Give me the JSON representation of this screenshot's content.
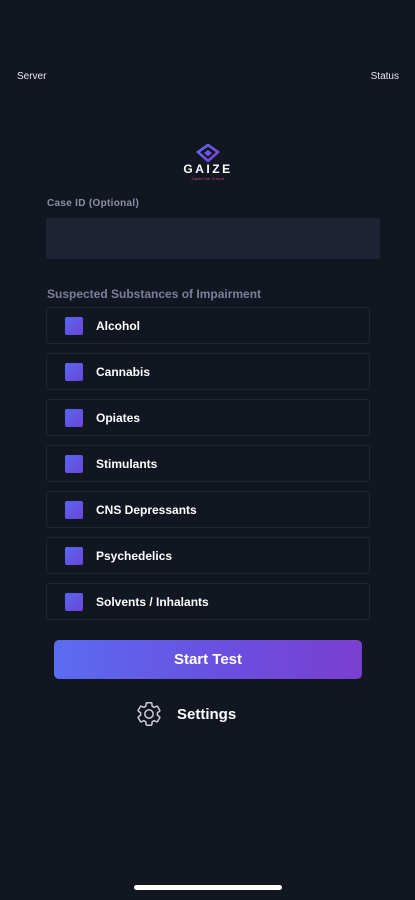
{
  "top_bar": {
    "server_label": "Server",
    "status_label": "Status"
  },
  "logo": {
    "wordmark": "GAIZE",
    "tagline": "Gaize the Future",
    "icon": "gaize-logo-icon"
  },
  "case_id": {
    "label": "Case ID (Optional)",
    "value": "",
    "placeholder": ""
  },
  "substances": {
    "section_label": "Suspected Substances of Impairment",
    "items": [
      {
        "label": "Alcohol"
      },
      {
        "label": "Cannabis"
      },
      {
        "label": "Opiates"
      },
      {
        "label": "Stimulants"
      },
      {
        "label": "CNS Depressants"
      },
      {
        "label": "Psychedelics"
      },
      {
        "label": "Solvents / Inhalants"
      }
    ]
  },
  "actions": {
    "start_label": "Start Test",
    "settings_label": "Settings",
    "settings_icon": "gear-icon"
  },
  "colors": {
    "background": "#121620",
    "input_bg": "#1e2433",
    "accent_start": "#5a6cf0",
    "accent_end": "#7a3fd0",
    "muted_text": "#8a91a7"
  }
}
